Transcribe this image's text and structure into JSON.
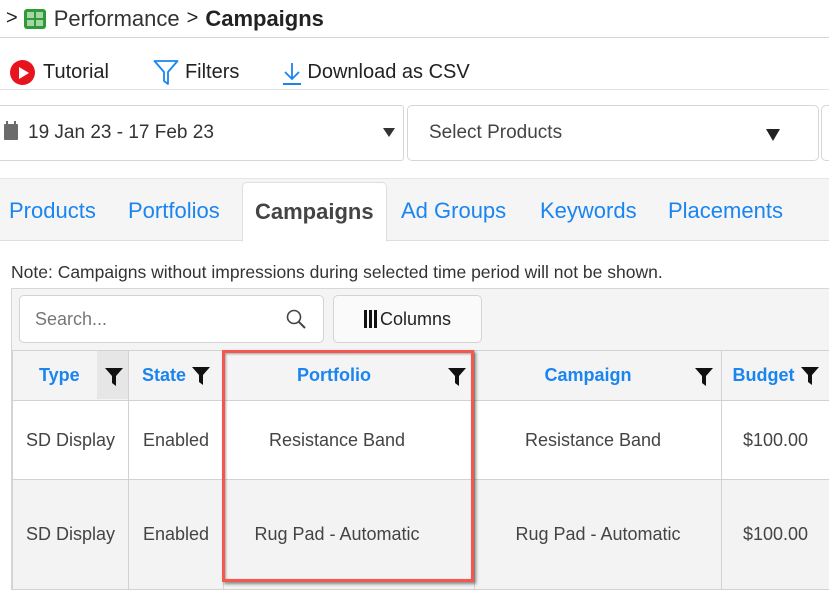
{
  "breadcrumb": {
    "prefix": ">",
    "icon": "sheet-grid-icon",
    "parent": "Performance",
    "separator": ">",
    "current": "Campaigns"
  },
  "toolbar": {
    "tutorial_label": "Tutorial",
    "filters_label": "Filters",
    "download_label": "Download as CSV"
  },
  "filters": {
    "date_range": "19 Jan 23 - 17 Feb 23",
    "products_placeholder": "Select Products"
  },
  "tabs": [
    {
      "label": "Products",
      "active": false
    },
    {
      "label": "Portfolios",
      "active": false
    },
    {
      "label": "Campaigns",
      "active": true
    },
    {
      "label": "Ad Groups",
      "active": false
    },
    {
      "label": "Keywords",
      "active": false
    },
    {
      "label": "Placements",
      "active": false
    }
  ],
  "note": "Note: Campaigns without impressions during selected time period will not be shown.",
  "grid": {
    "search_placeholder": "Search...",
    "columns_label": "Columns",
    "headers": [
      "Type",
      "State",
      "Portfolio",
      "Campaign",
      "Budget"
    ],
    "rows": [
      {
        "type": "SD Display",
        "state": "Enabled",
        "portfolio": "Resistance Band",
        "campaign": "Resistance Band",
        "budget": "$100.00"
      },
      {
        "type": "SD Display",
        "state": "Enabled",
        "portfolio": "Rug Pad - Automatic",
        "campaign": "Rug Pad - Automatic",
        "budget": "$100.00"
      }
    ]
  },
  "colors": {
    "link_blue": "#1a85f0",
    "highlight_red": "#f2584e",
    "tutorial_red": "#e8141d",
    "sheet_green": "#2e9a3a"
  }
}
